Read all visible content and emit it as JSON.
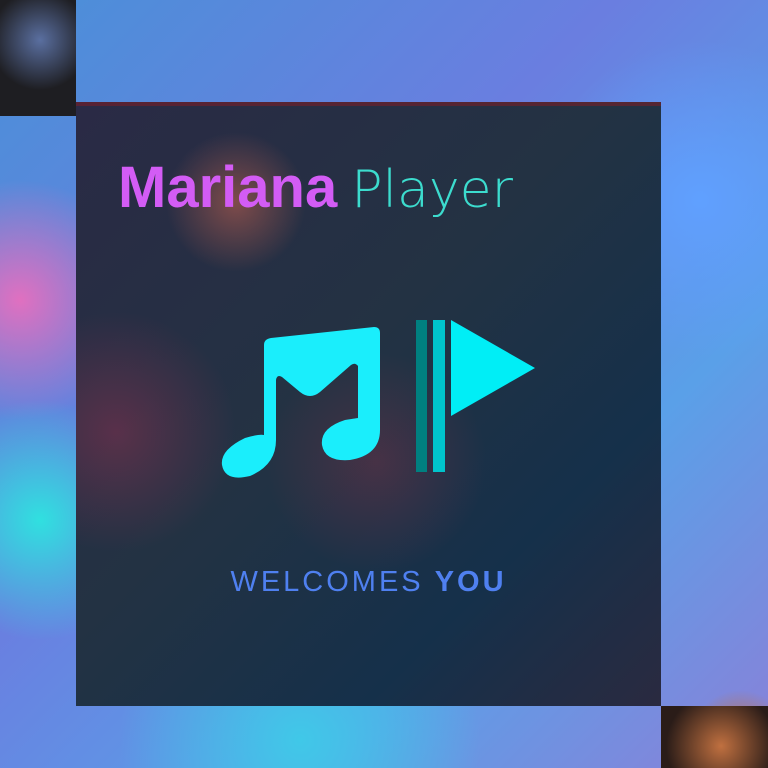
{
  "title": {
    "brand": "Mariana",
    "product": "Player"
  },
  "tagline": {
    "prefix": "WELCOMES",
    "emphasis": "YOU"
  },
  "colors": {
    "brand": "#d35cf5",
    "product": "#3ee6d6",
    "icon": "#1aeefc",
    "bar_dark": "#008080",
    "bar_light": "#00c4cc",
    "tagline": "#4f80f0"
  },
  "icons": [
    "music-note-icon",
    "play-flag-icon"
  ]
}
